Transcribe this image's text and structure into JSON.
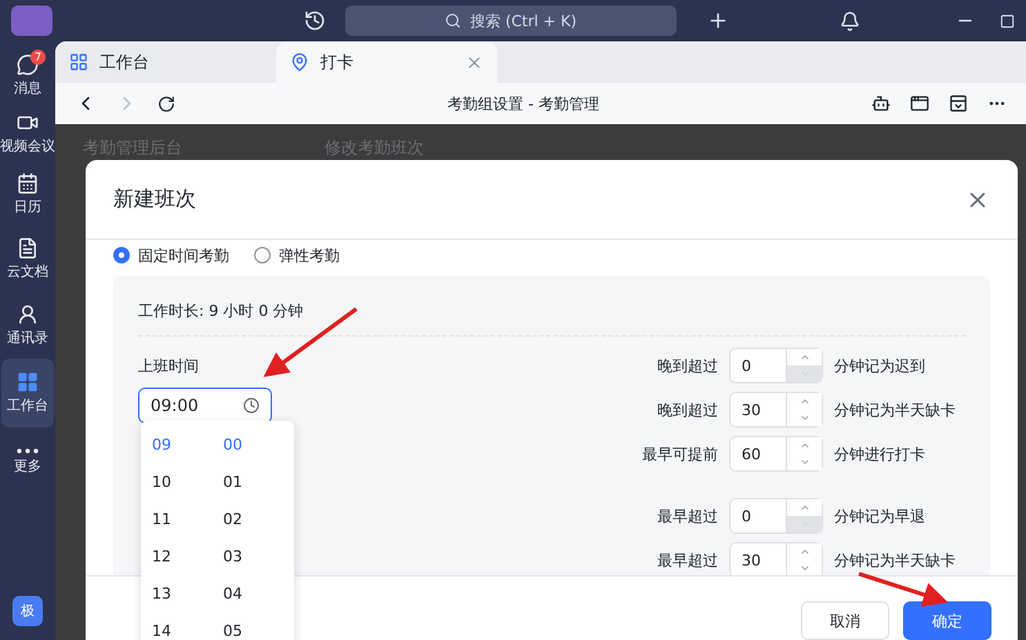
{
  "top_bar": {
    "search_placeholder": "搜索 (Ctrl + K)"
  },
  "sidebar": {
    "items": [
      {
        "kind": "chat",
        "label": "消息",
        "badge": "7",
        "selected": false
      },
      {
        "kind": "video",
        "label": "视频会议",
        "selected": false
      },
      {
        "kind": "calendar",
        "label": "日历",
        "selected": false
      },
      {
        "kind": "docs",
        "label": "云文档",
        "selected": false
      },
      {
        "kind": "contacts",
        "label": "通讯录",
        "selected": false
      },
      {
        "kind": "apps",
        "label": "工作台",
        "selected": true
      },
      {
        "kind": "more",
        "label": "更多",
        "selected": false
      }
    ],
    "avatar": "极"
  },
  "tabs": [
    {
      "kind": "apps",
      "label": "工作台",
      "selected": false
    },
    {
      "kind": "pin",
      "label": "打卡",
      "selected": true
    }
  ],
  "address_bar": {
    "title": "考勤组设置 - 考勤管理"
  },
  "background": {
    "left_title": "考勤管理后台",
    "right_title": "修改考勤班次"
  },
  "dialog": {
    "title": "新建班次",
    "modes": [
      {
        "label": "固定时间考勤",
        "selected": true
      },
      {
        "label": "弹性考勤",
        "selected": false
      }
    ],
    "duration": "工作时长: 9 小时 0 分钟",
    "start_label": "上班时间",
    "start_value": "09:00",
    "time_picker": {
      "hours": [
        {
          "label": "09",
          "selected": true
        },
        {
          "label": "10",
          "selected": false
        },
        {
          "label": "11",
          "selected": false
        },
        {
          "label": "12",
          "selected": false
        },
        {
          "label": "13",
          "selected": false
        },
        {
          "label": "14",
          "selected": false
        }
      ],
      "minutes": [
        {
          "label": "00",
          "selected": true
        },
        {
          "label": "01",
          "selected": false
        },
        {
          "label": "02",
          "selected": false
        },
        {
          "label": "03",
          "selected": false
        },
        {
          "label": "04",
          "selected": false
        },
        {
          "label": "05",
          "selected": false
        }
      ]
    },
    "rule_groups": [
      {
        "rules": [
          {
            "prefix": "晚到超过",
            "value": "0",
            "suffix": "分钟记为迟到",
            "down_disabled": true
          },
          {
            "prefix": "晚到超过",
            "value": "30",
            "suffix": "分钟记为半天缺卡",
            "down_disabled": false
          },
          {
            "prefix": "最早可提前",
            "value": "60",
            "suffix": "分钟进行打卡",
            "down_disabled": false
          }
        ]
      },
      {
        "rules": [
          {
            "prefix": "最早超过",
            "value": "0",
            "suffix": "分钟记为早退",
            "down_disabled": true
          },
          {
            "prefix": "最早超过",
            "value": "30",
            "suffix": "分钟记为半天缺卡",
            "down_disabled": false
          }
        ]
      }
    ],
    "buttons": [
      {
        "kind": "secondary",
        "label": "取消"
      },
      {
        "kind": "primary",
        "label": "确定"
      }
    ]
  }
}
